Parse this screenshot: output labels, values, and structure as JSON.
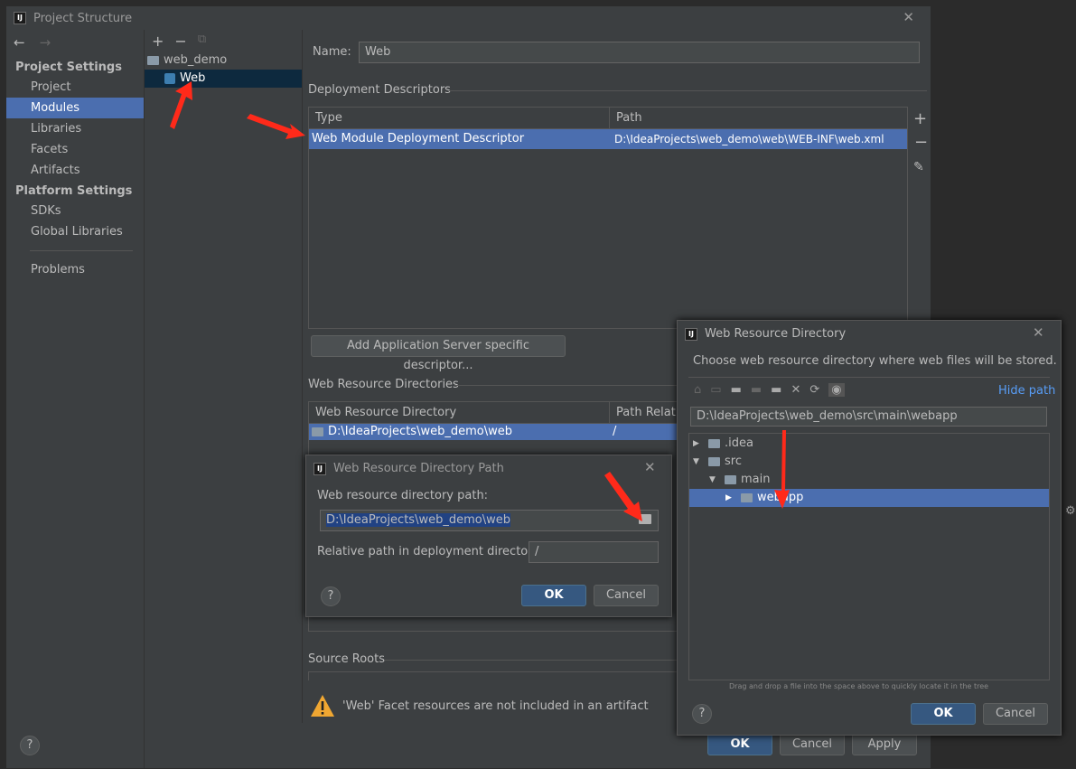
{
  "window": {
    "title": "Project Structure"
  },
  "sidebar": {
    "project_settings": "Project Settings",
    "project_items": [
      "Project",
      "Modules",
      "Libraries",
      "Facets",
      "Artifacts"
    ],
    "platform_settings": "Platform Settings",
    "platform_items": [
      "SDKs",
      "Global Libraries"
    ],
    "problems": "Problems"
  },
  "modules": {
    "root": "web_demo",
    "child": "Web"
  },
  "name": {
    "label": "Name:",
    "value": "Web"
  },
  "deployment": {
    "title": "Deployment Descriptors",
    "col_type": "Type",
    "col_path": "Path",
    "row_type": "Web Module Deployment Descriptor",
    "row_path": "D:\\IdeaProjects\\web_demo\\web\\WEB-INF\\web.xml",
    "add_button": "Add Application Server specific descriptor..."
  },
  "web_resources": {
    "title": "Web Resource Directories",
    "col_dir": "Web Resource Directory",
    "col_rel": "Path Relative",
    "row_dir": "D:\\IdeaProjects\\web_demo\\web",
    "row_rel": "/"
  },
  "source_roots": {
    "title": "Source Roots"
  },
  "warning": "'Web' Facet resources are not included in an artifact",
  "footer": {
    "ok": "OK",
    "cancel": "Cancel",
    "apply": "Apply",
    "help": "?"
  },
  "path_dialog": {
    "title": "Web Resource Directory Path",
    "label": "Web resource directory path:",
    "value": "D:\\IdeaProjects\\web_demo\\web",
    "rel_label": "Relative path in deployment directory:",
    "rel_value": "/",
    "ok": "OK",
    "cancel": "Cancel",
    "help": "?"
  },
  "chooser_dialog": {
    "title": "Web Resource Directory",
    "description": "Choose web resource directory where web files will be stored.",
    "hide_path": "Hide path",
    "path": "D:\\IdeaProjects\\web_demo\\src\\main\\webapp",
    "tree": [
      {
        "label": ".idea",
        "arrow": "▶"
      },
      {
        "label": "src",
        "arrow": "▼"
      },
      {
        "label": "main",
        "arrow": "▼"
      },
      {
        "label": "webapp",
        "arrow": "▶"
      }
    ],
    "hint": "Drag and drop a file into the space above to quickly locate it in the tree",
    "ok": "OK",
    "cancel": "Cancel",
    "help": "?"
  },
  "colors": {
    "accent": "#4b6eaf",
    "background": "#3c3f41",
    "arrow": "#ff2a1a"
  }
}
